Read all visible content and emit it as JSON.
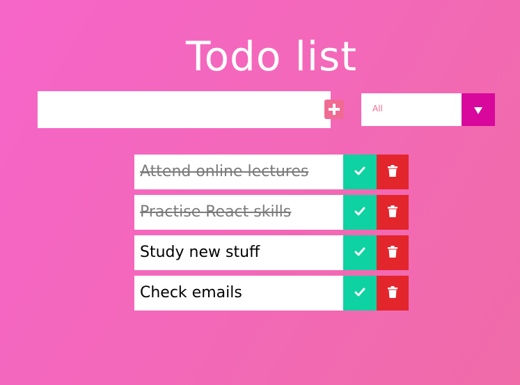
{
  "app": {
    "title": "Todo list"
  },
  "input": {
    "value": "",
    "placeholder": ""
  },
  "add_button": {
    "icon": "plus-square-icon"
  },
  "filter": {
    "selected": "All",
    "icon": "triangle-down-icon"
  },
  "todos": [
    {
      "text": "Attend online lectures",
      "completed": true
    },
    {
      "text": "Practise React skills",
      "completed": true
    },
    {
      "text": "Study new stuff",
      "completed": false
    },
    {
      "text": "Check emails",
      "completed": false
    }
  ],
  "icons": {
    "complete": "check-icon",
    "delete": "trash-icon"
  },
  "colors": {
    "background_start": "#f665c9",
    "background_end": "#f06ba8",
    "add_button": "#f06b93",
    "filter_arrow": "#d7089b",
    "complete_button": "#0ed2a1",
    "delete_button": "#e3252c"
  }
}
